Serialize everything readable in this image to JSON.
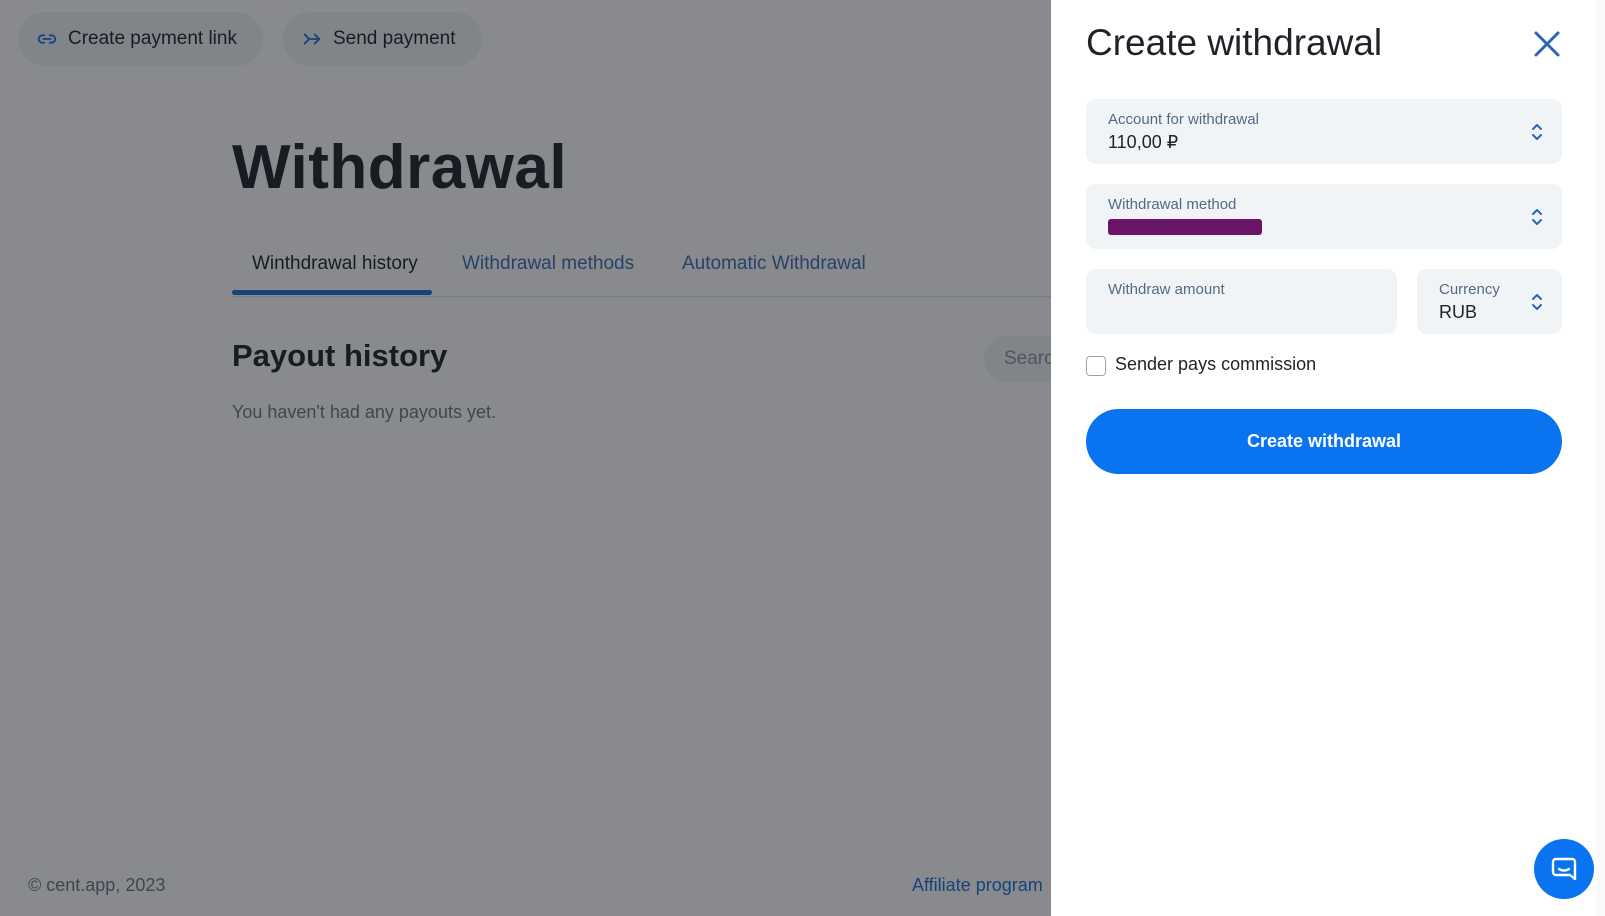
{
  "topbar": {
    "create_link_label": "Create payment link",
    "send_payment_label": "Send payment"
  },
  "page": {
    "title": "Withdrawal",
    "tabs": [
      {
        "label": "Winthdrawal history",
        "active": true
      },
      {
        "label": "Withdrawal methods",
        "active": false
      },
      {
        "label": "Automatic Withdrawal",
        "active": false
      }
    ],
    "section_title": "Payout history",
    "search_placeholder": "Search",
    "empty_text": "You haven't had any payouts yet."
  },
  "footer": {
    "copyright": "© cent.app, 2023",
    "affiliate": "Affiliate program"
  },
  "panel": {
    "title": "Create withdrawal",
    "account": {
      "label": "Account for withdrawal",
      "value": "110,00 ₽"
    },
    "method": {
      "label": "Withdrawal method",
      "value_redacted": true
    },
    "amount": {
      "label": "Withdraw amount",
      "value": ""
    },
    "currency": {
      "label": "Currency",
      "value": "RUB"
    },
    "sender_pays_label": "Sender pays commission",
    "sender_pays_checked": false,
    "submit_label": "Create withdrawal"
  },
  "colors": {
    "accent": "#0a73f0",
    "redaction": "#6b1566"
  },
  "icons": {
    "create_link": "link-icon",
    "send_payment": "double-arrow-right-icon",
    "close": "close-icon",
    "select": "chevron-updown-icon",
    "chat": "chat-icon"
  }
}
